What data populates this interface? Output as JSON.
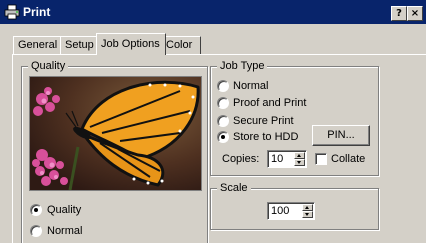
{
  "window": {
    "title": "Print",
    "help_button": "?",
    "close_button": "×",
    "colors": {
      "titlebar": "#08246b",
      "face": "#d4d0c8"
    }
  },
  "tabs": [
    {
      "label": "General",
      "active": false
    },
    {
      "label": "Setup",
      "active": false
    },
    {
      "label": "Job Options",
      "active": true
    },
    {
      "label": "Color",
      "active": false
    }
  ],
  "quality": {
    "legend": "Quality",
    "preview_image": "monarch-butterfly-on-pink-flowers",
    "options": [
      {
        "label": "Quality",
        "selected": true
      },
      {
        "label": "Normal",
        "selected": false
      }
    ]
  },
  "job_type": {
    "legend": "Job Type",
    "options": [
      {
        "label": "Normal",
        "selected": false
      },
      {
        "label": "Proof and Print",
        "selected": false
      },
      {
        "label": "Secure Print",
        "selected": false
      },
      {
        "label": "Store to HDD",
        "selected": true
      }
    ],
    "pin_button": "PIN...",
    "copies_label": "Copies:",
    "copies_value": "10",
    "collate_label": "Collate",
    "collate_checked": false
  },
  "scale": {
    "legend": "Scale",
    "value": "100"
  }
}
